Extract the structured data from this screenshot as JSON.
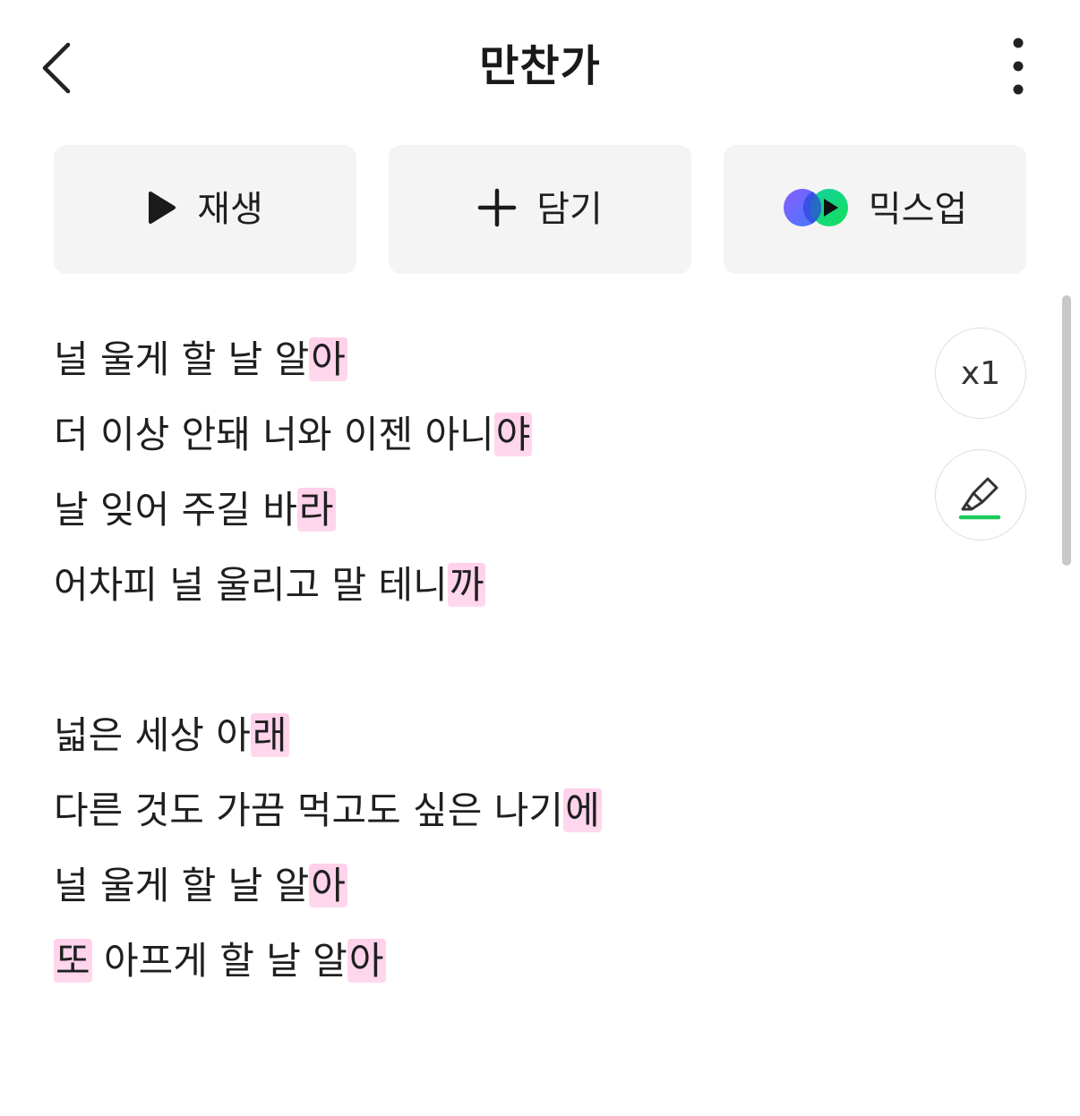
{
  "header": {
    "title": "만찬가"
  },
  "actions": {
    "play_label": "재생",
    "add_label": "담기",
    "mixup_label": "믹스업"
  },
  "tools": {
    "speed_label": "x1"
  },
  "lyrics": {
    "verse1": [
      {
        "main": "널 울게 할 날 알",
        "hl": "아"
      },
      {
        "main": "더 이상 안돼 너와 이젠 아니",
        "hl": "야"
      },
      {
        "main": "날 잊어 주길 바",
        "hl": "라"
      },
      {
        "main": "어차피 널 울리고 말 테니",
        "hl": "까"
      }
    ],
    "verse2": [
      {
        "main": "넓은 세상 아",
        "hl": "래"
      },
      {
        "main": "다른 것도 가끔 먹고도 싶은 나기",
        "hl": "에"
      },
      {
        "main": "널 울게 할 날 알",
        "hl": "아"
      },
      {
        "pre_hl": "또",
        "main": " 아프게 할 날 알",
        "hl": "아"
      }
    ]
  },
  "colors": {
    "highlight": "#ffd2eb",
    "button_bg": "#f4f4f4",
    "accent_green": "#1ec95c"
  },
  "icons": {
    "back": "chevron-left-icon",
    "more": "more-vertical-icon",
    "play": "play-icon",
    "add": "plus-icon",
    "mixup": "mixup-logo-icon",
    "highlighter": "highlighter-icon"
  }
}
